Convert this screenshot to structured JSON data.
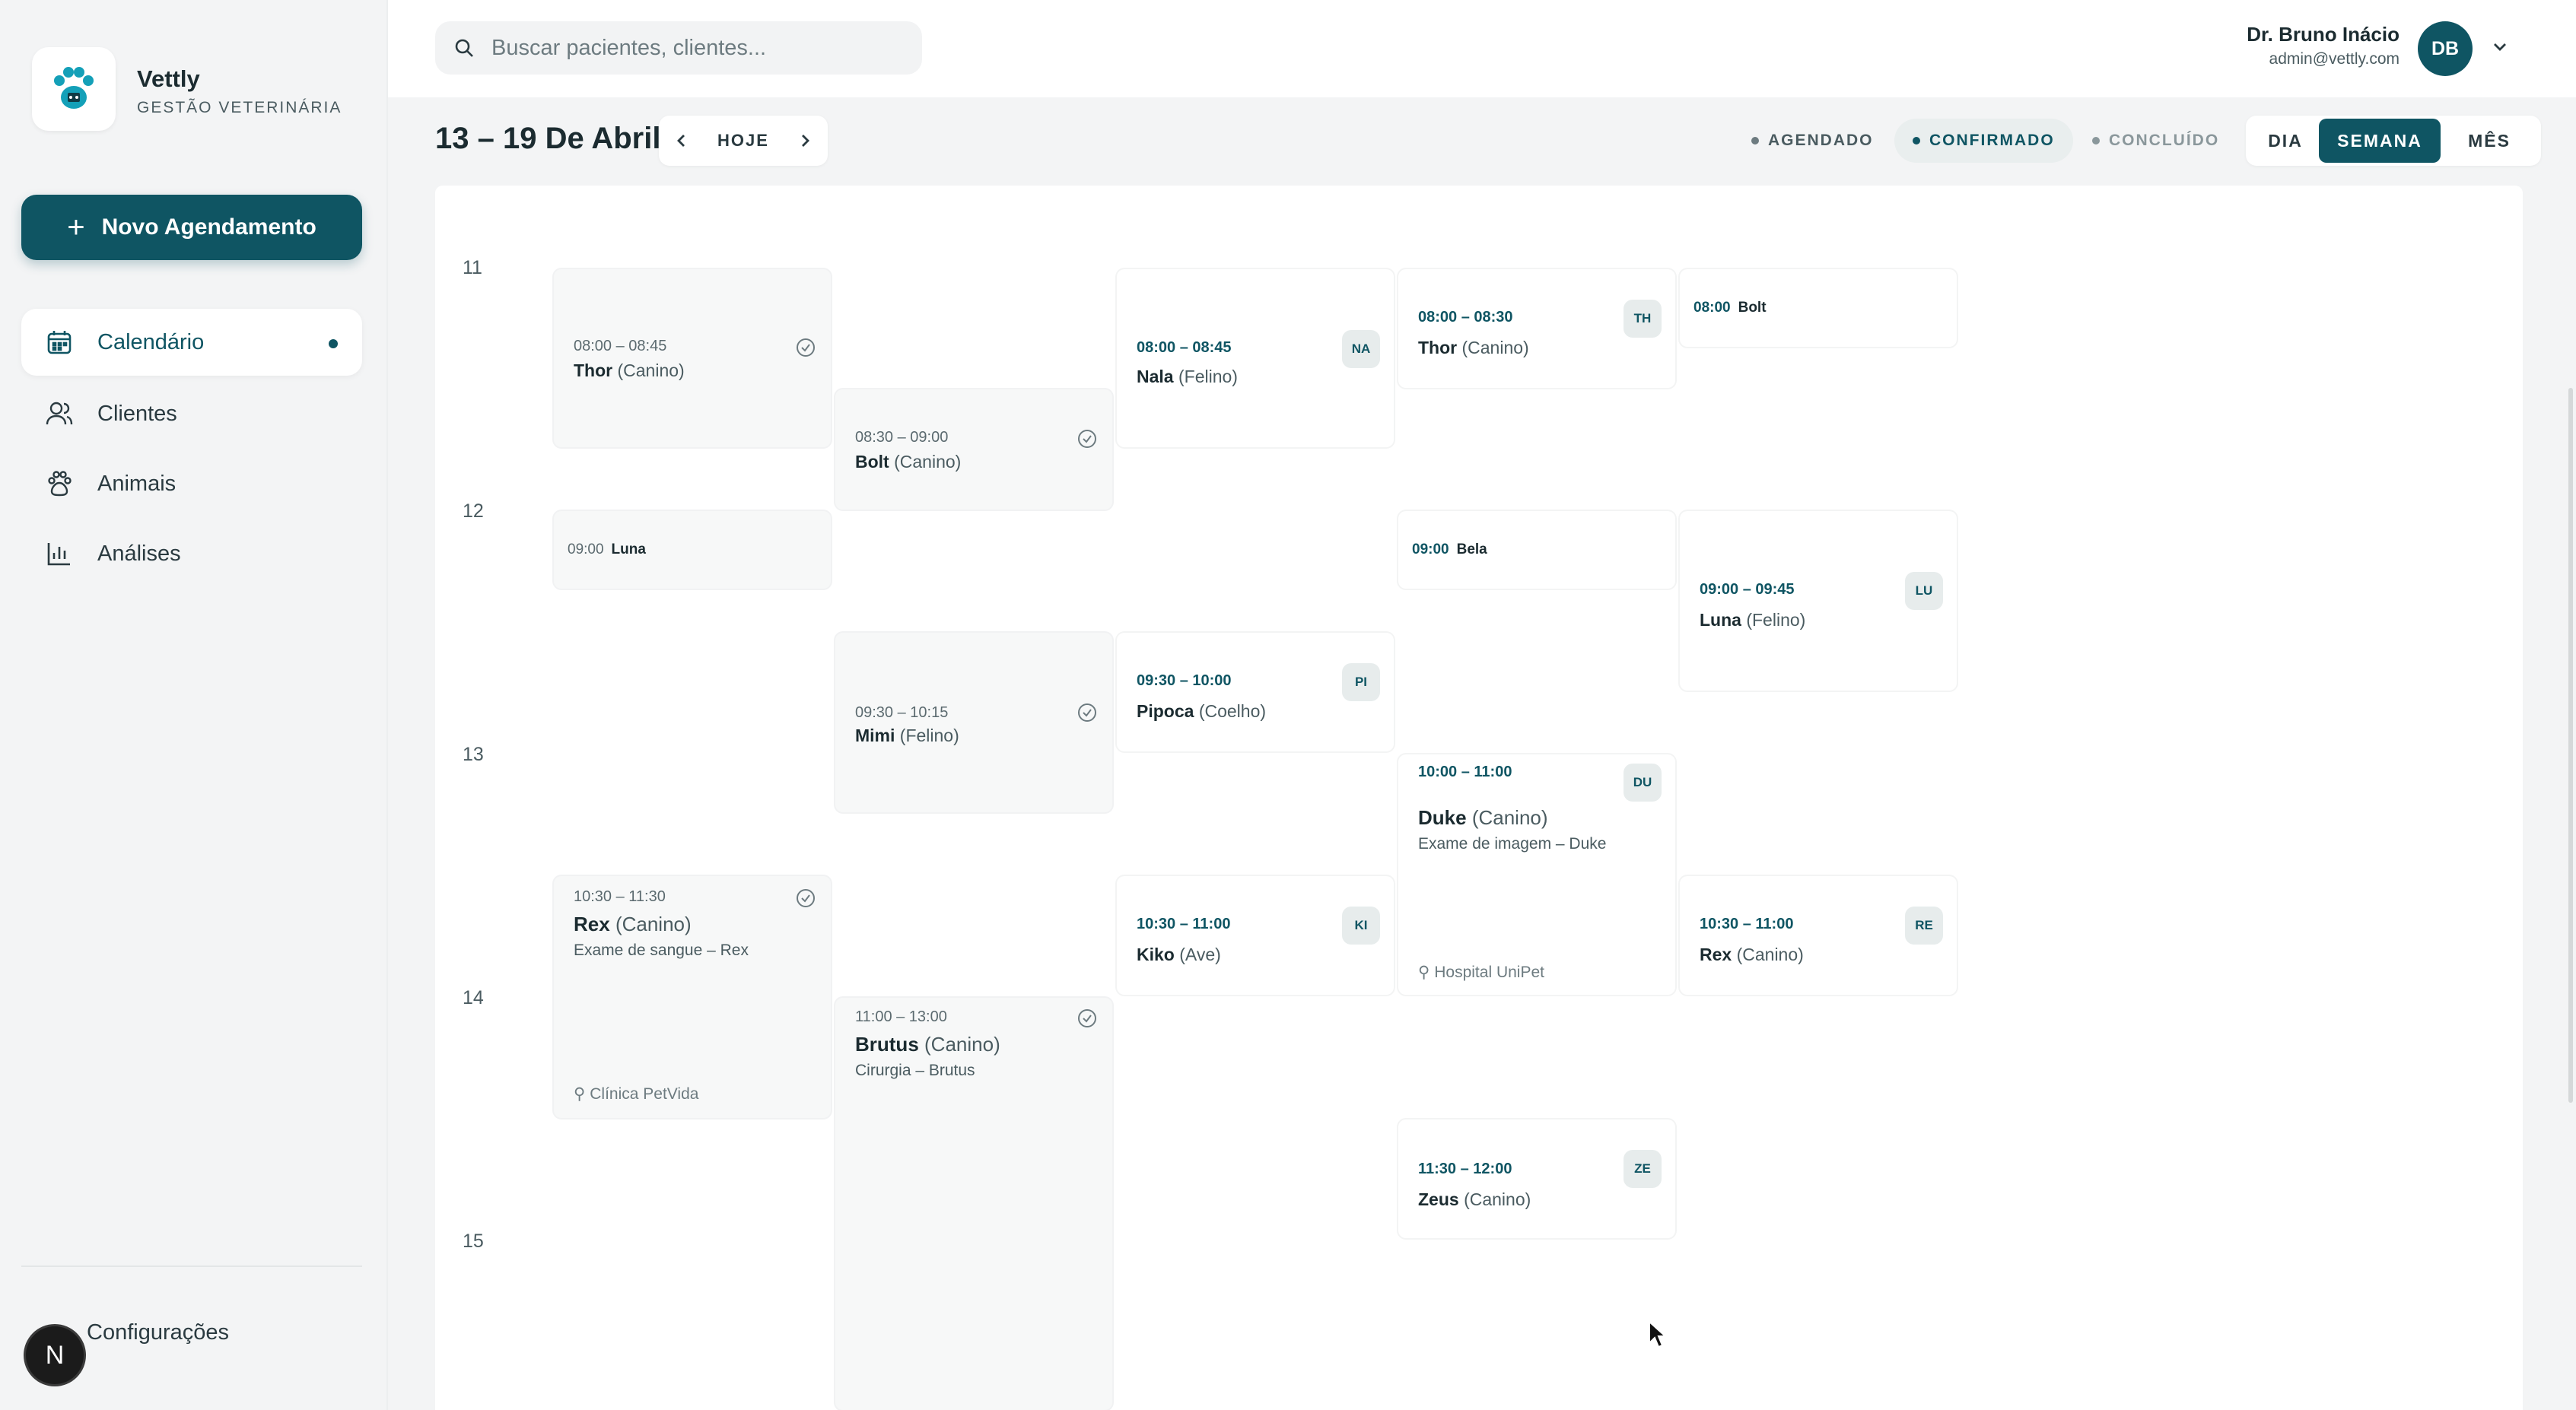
{
  "brand": {
    "name": "Vettly",
    "subtitle": "GESTÃO VETERINÁRIA"
  },
  "sidebar": {
    "new_button": "Novo Agendamento",
    "items": [
      {
        "label": "Calendário",
        "icon": "calendar-icon",
        "active": true
      },
      {
        "label": "Clientes",
        "icon": "users-icon"
      },
      {
        "label": "Animais",
        "icon": "paw-icon"
      },
      {
        "label": "Análises",
        "icon": "bar-chart-icon"
      }
    ],
    "settings": "Configurações",
    "n_badge": "N"
  },
  "header": {
    "search_placeholder": "Buscar pacientes, clientes...",
    "user_name": "Dr. Bruno Inácio",
    "user_email": "admin@vettly.com",
    "avatar": "DB"
  },
  "toolbar": {
    "week_title": "13 – 19 De Abril",
    "today": "HOJE",
    "filters": [
      {
        "label": "AGENDADO",
        "color": "#6d7b80"
      },
      {
        "label": "CONFIRMADO",
        "color": "#0f5563"
      },
      {
        "label": "CONCLUÍDO",
        "color": "#8a979b"
      }
    ],
    "views": [
      "DIA",
      "SEMANA",
      "MÊS"
    ],
    "active_view": "SEMANA"
  },
  "calendar": {
    "hours": [
      "11",
      "12",
      "13",
      "14",
      "15"
    ],
    "events": [
      {
        "time": "08:00 – 08:45",
        "name": "Thor",
        "species": "(Canino)",
        "status": "concluido"
      },
      {
        "time": "08:30 – 09:00",
        "name": "Bolt",
        "species": "(Canino)",
        "status": "concluido"
      },
      {
        "time": "08:00 – 08:45",
        "name": "Nala",
        "species": "(Felino)",
        "badge": "NA"
      },
      {
        "time": "08:00 – 08:30",
        "name": "Thor",
        "species": "(Canino)",
        "badge": "TH"
      },
      {
        "time": "08:00",
        "name": "Bolt"
      },
      {
        "time": "09:00",
        "name": "Luna"
      },
      {
        "time": "09:00",
        "name": "Bela"
      },
      {
        "time": "09:00 – 09:45",
        "name": "Luna",
        "species": "(Felino)",
        "badge": "LU"
      },
      {
        "time": "09:30 – 10:15",
        "name": "Mimi",
        "species": "(Felino)",
        "status": "concluido"
      },
      {
        "time": "09:30 – 10:00",
        "name": "Pipoca",
        "species": "(Coelho)",
        "badge": "PI"
      },
      {
        "time": "10:00 – 11:00",
        "name": "Duke",
        "species": "(Canino)",
        "desc": "Exame de imagem – Duke",
        "location": "Hospital UniPet",
        "badge": "DU"
      },
      {
        "time": "10:30 – 11:30",
        "name": "Rex",
        "species": "(Canino)",
        "desc": "Exame de sangue – Rex",
        "location": "Clínica PetVida",
        "status": "concluido"
      },
      {
        "time": "10:30 – 11:00",
        "name": "Kiko",
        "species": "(Ave)",
        "badge": "KI"
      },
      {
        "time": "10:30 – 11:00",
        "name": "Rex",
        "species": "(Canino)",
        "badge": "RE"
      },
      {
        "time": "11:00 – 13:00",
        "name": "Brutus",
        "species": "(Canino)",
        "desc": "Cirurgia – Brutus",
        "status": "concluido"
      },
      {
        "time": "11:30 – 12:00",
        "name": "Zeus",
        "species": "(Canino)",
        "badge": "ZE"
      }
    ]
  }
}
